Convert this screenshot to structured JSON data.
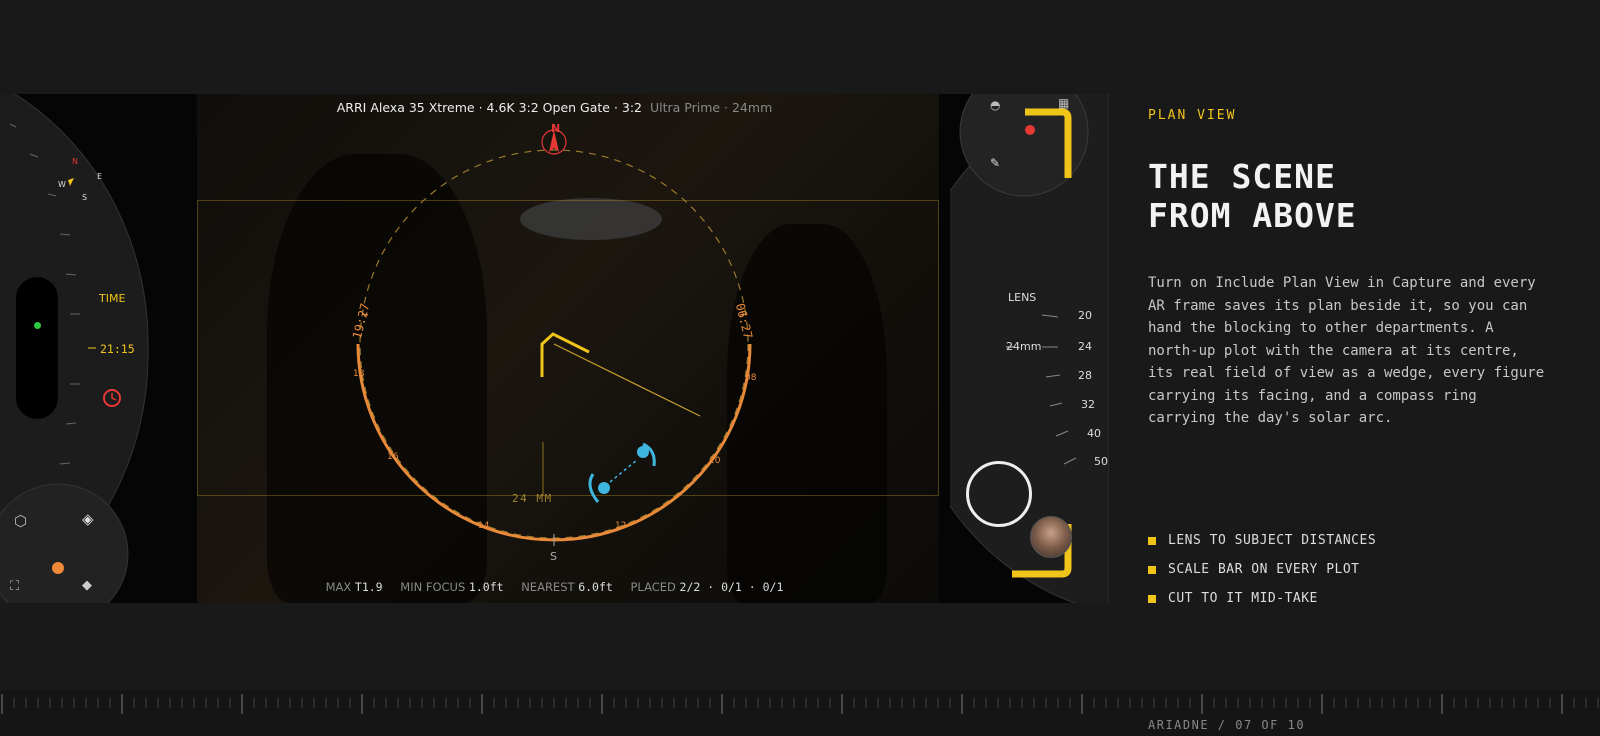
{
  "camera": {
    "info_main": "ARRI Alexa 35 Xtreme · 4.6K 3:2 Open Gate · 3:2",
    "info_lens": "Ultra Prime · 24mm"
  },
  "plan": {
    "north": "N",
    "south": "S",
    "lens_label": "24 MM",
    "time_left": "19:27",
    "time_right": "06:27",
    "hours": [
      "18",
      "16",
      "14",
      "12",
      "10",
      "08"
    ]
  },
  "stats": {
    "max_label": "MAX",
    "max_value": "T1.9",
    "minfocus_label": "MIN FOCUS",
    "minfocus_value": "1.0ft",
    "nearest_label": "NEAREST",
    "nearest_value": "6.0ft",
    "placed_label": "PLACED",
    "placed_value": "2/2 · 0/1 · 0/1"
  },
  "left_panel": {
    "compass": {
      "n": "N",
      "e": "E",
      "s": "S",
      "w": "W"
    },
    "time_label": "TIME",
    "time_value": "21:15"
  },
  "right_panel": {
    "lens_label": "LENS",
    "lens_value": "24mm",
    "focal_ticks": [
      "20",
      "24",
      "28",
      "32",
      "40",
      "50"
    ]
  },
  "sidebar": {
    "eyebrow": "PLAN VIEW",
    "headline_1": "THE SCENE",
    "headline_2": "FROM ABOVE",
    "body": "Turn on Include Plan View in Capture and every AR frame saves its plan beside it, so you can hand the blocking to other departments. A north-up plot with the camera at its centre, its real field of view as a wedge, every figure carrying its facing, and a compass ring carrying the day's solar arc.",
    "bullets": [
      "LENS TO SUBJECT DISTANCES",
      "SCALE BAR ON EVERY PLOT",
      "CUT TO IT MID-TAKE"
    ]
  },
  "footer": "ARIADNE / 07 OF 10",
  "colors": {
    "accent": "#f0c419",
    "sun_arc": "#e88a3a",
    "figure": "#3fb6e0",
    "north": "#e53935",
    "background": "#191919"
  }
}
